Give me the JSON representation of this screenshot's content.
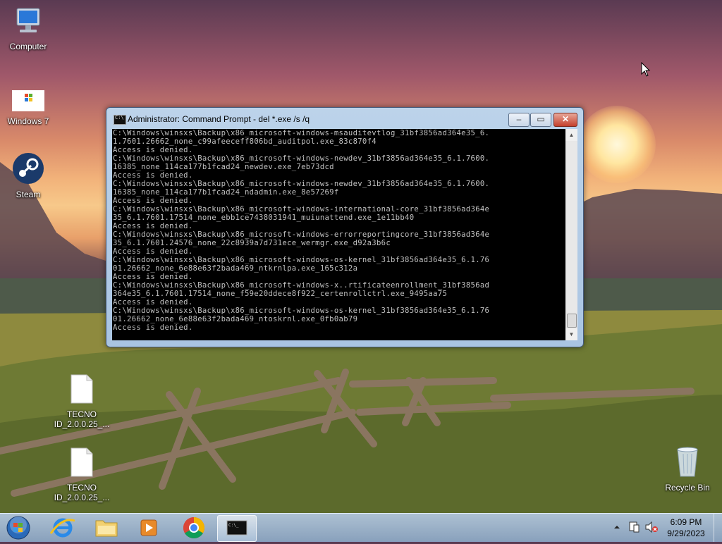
{
  "desktop": {
    "icons": [
      {
        "label": "Computer"
      },
      {
        "label": "Windows 7"
      },
      {
        "label": "Steam"
      },
      {
        "label": "TECNO ID_2.0.0.25_..."
      },
      {
        "label": "TECNO ID_2.0.0.25_..."
      },
      {
        "label": "Recycle Bin"
      }
    ]
  },
  "window": {
    "title": "Administrator:  Command Prompt - del  *.exe /s /q",
    "console_lines": [
      "C:\\Windows\\winsxs\\Backup\\x86_microsoft-windows-msauditevtlog_31bf3856ad364e35_6.",
      "1.7601.26662_none_c99afeeceff806bd_auditpol.exe_83c870f4",
      "Access is denied.",
      "C:\\Windows\\winsxs\\Backup\\x86_microsoft-windows-newdev_31bf3856ad364e35_6.1.7600.",
      "16385_none_114ca177b1fcad24_newdev.exe_7eb73dcd",
      "Access is denied.",
      "C:\\Windows\\winsxs\\Backup\\x86_microsoft-windows-newdev_31bf3856ad364e35_6.1.7600.",
      "16385_none_114ca177b1fcad24_ndadmin.exe_8e57269f",
      "Access is denied.",
      "C:\\Windows\\winsxs\\Backup\\x86_microsoft-windows-international-core_31bf3856ad364e",
      "35_6.1.7601.17514_none_ebb1ce7438031941_muiunattend.exe_1e11bb40",
      "Access is denied.",
      "C:\\Windows\\winsxs\\Backup\\x86_microsoft-windows-errorreportingcore_31bf3856ad364e",
      "35_6.1.7601.24576_none_22c8939a7d731ece_wermgr.exe_d92a3b6c",
      "Access is denied.",
      "C:\\Windows\\winsxs\\Backup\\x86_microsoft-windows-os-kernel_31bf3856ad364e35_6.1.76",
      "01.26662_none_6e88e63f2bada469_ntkrnlpa.exe_165c312a",
      "Access is denied.",
      "C:\\Windows\\winsxs\\Backup\\x86_microsoft-windows-x..rtificateenrollment_31bf3856ad",
      "364e35_6.1.7601.17514_none_f59e20ddece8f922_certenrollctrl.exe_9495aa75",
      "Access is denied.",
      "C:\\Windows\\winsxs\\Backup\\x86_microsoft-windows-os-kernel_31bf3856ad364e35_6.1.76",
      "01.26662_none_6e88e63f2bada469_ntoskrnl.exe_0fb0ab79",
      "Access is denied."
    ],
    "controls": {
      "minimize": "–",
      "maximize": "▭",
      "close": "✕"
    }
  },
  "taskbar": {
    "clock_time": "6:09 PM",
    "clock_date": "9/29/2023"
  },
  "colors": {
    "console_bg": "#000000",
    "console_fg": "#c0c0c0",
    "close_red": "#c4402c"
  }
}
